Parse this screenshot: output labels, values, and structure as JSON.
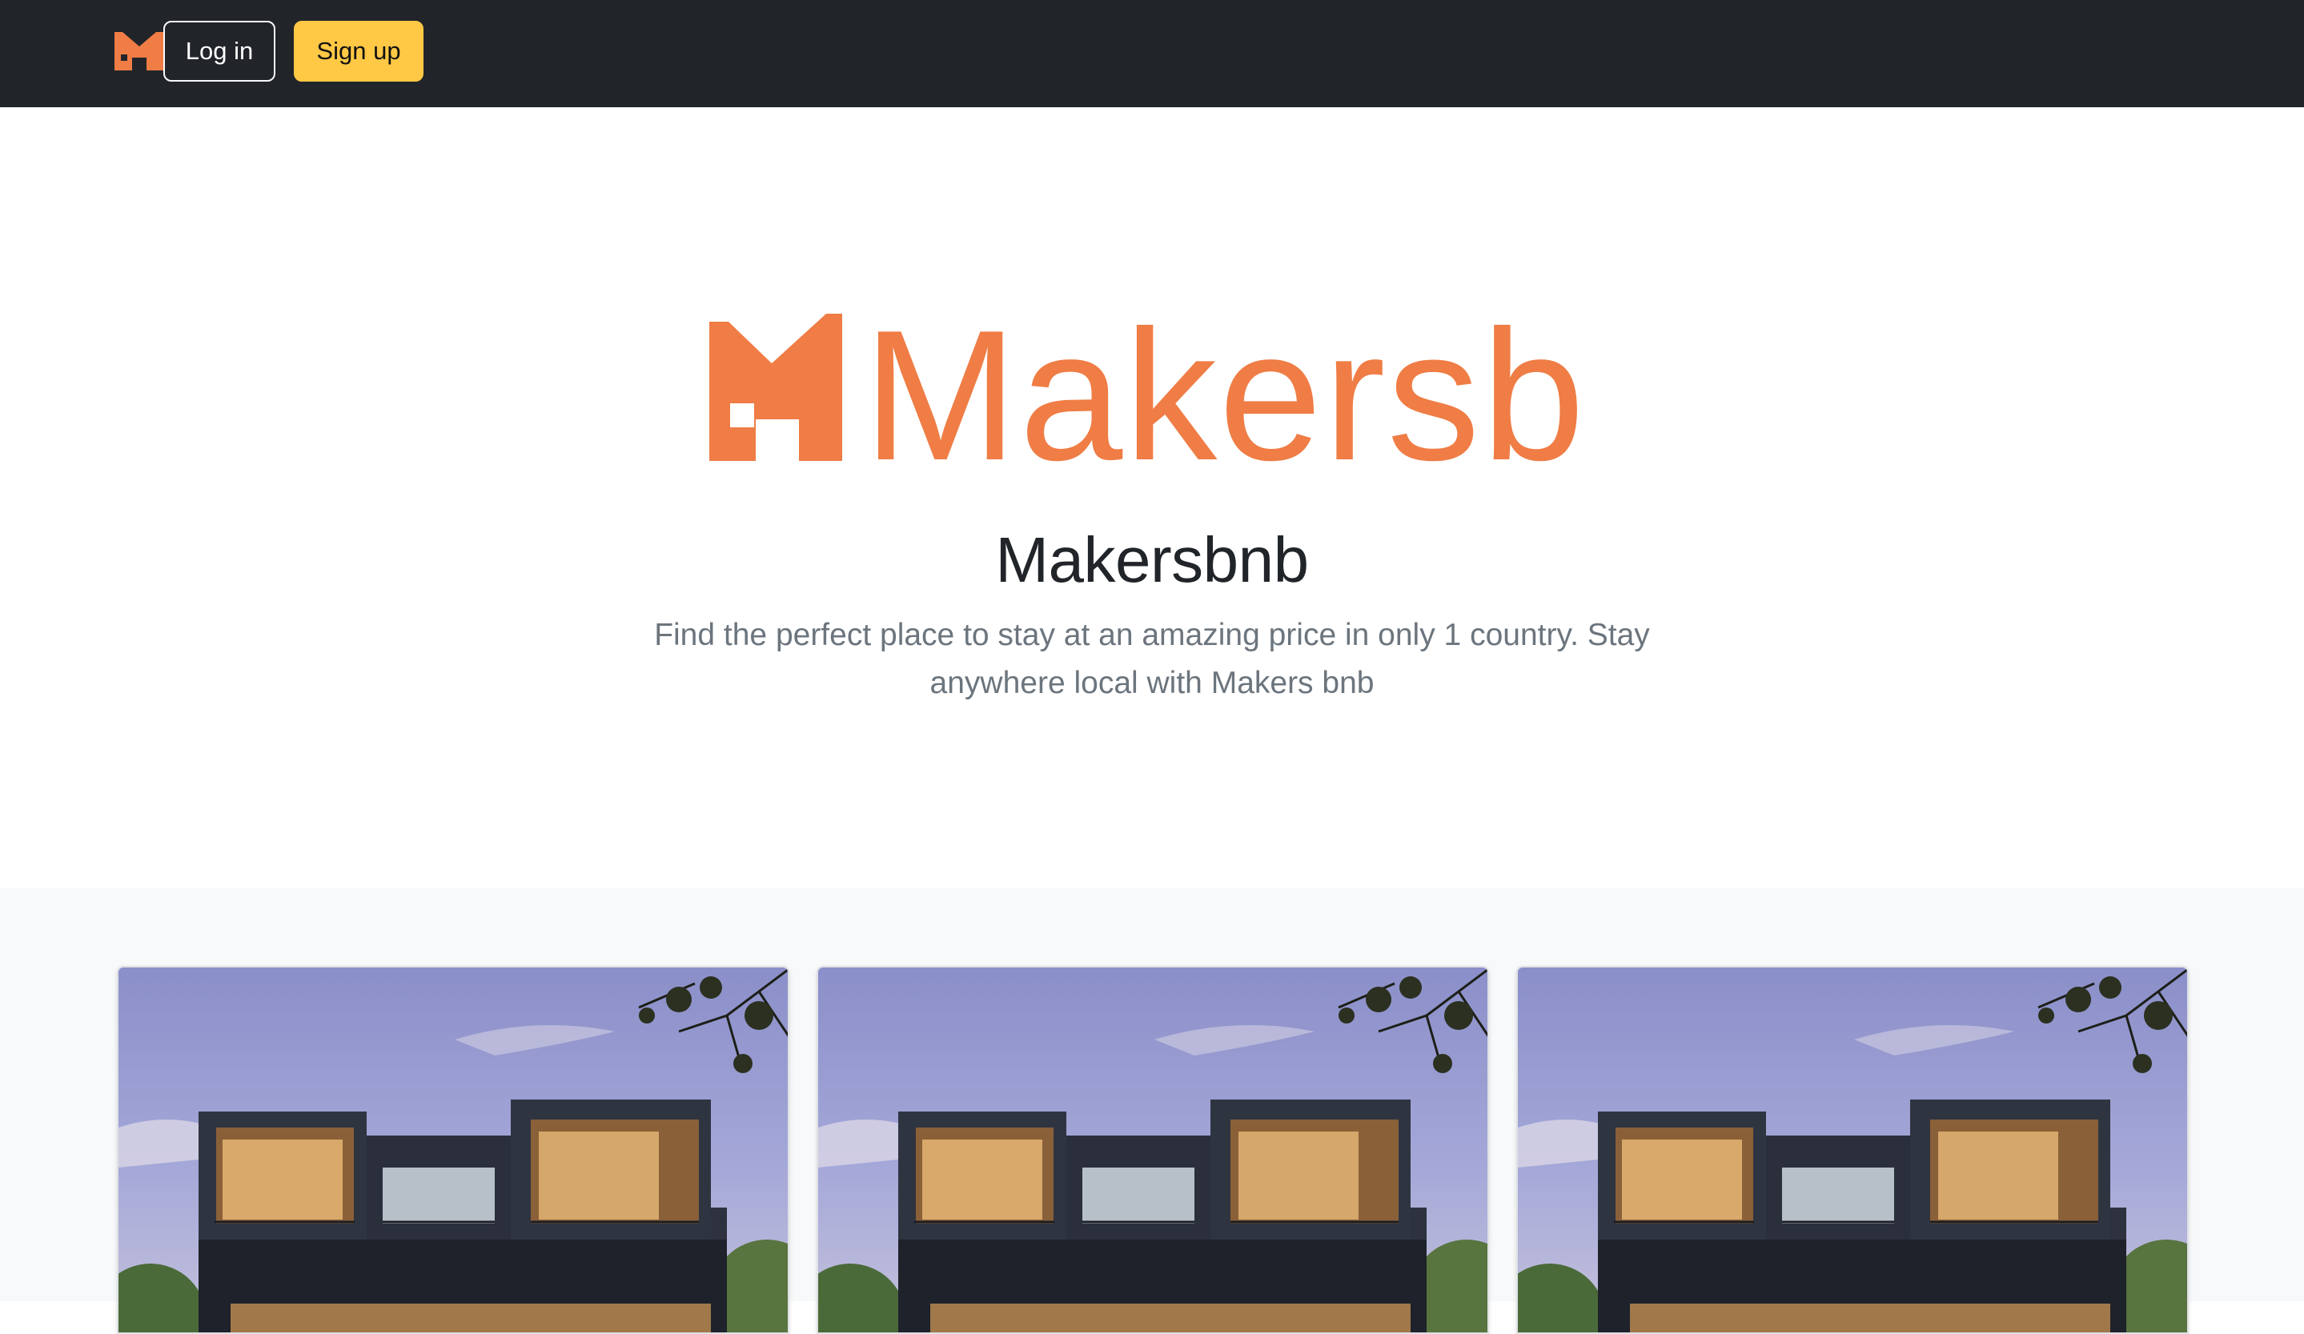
{
  "navbar": {
    "logo_icon": "makersbnb-m-logo-icon",
    "login_label": "Log in",
    "signup_label": "Sign up",
    "colors": {
      "background": "#212529",
      "signup": "#ffc845"
    }
  },
  "hero": {
    "logo_text": "Makersbnb",
    "title": "Makersbnb",
    "text": "Find the perfect place to stay at an amazing price in only 1 country. Stay anywhere local with Makers bnb",
    "colors": {
      "brand": "#ef7d45"
    }
  },
  "listings": {
    "cards": [
      {
        "image": "modern-house-photo"
      },
      {
        "image": "modern-house-photo"
      },
      {
        "image": "modern-house-photo"
      }
    ]
  }
}
